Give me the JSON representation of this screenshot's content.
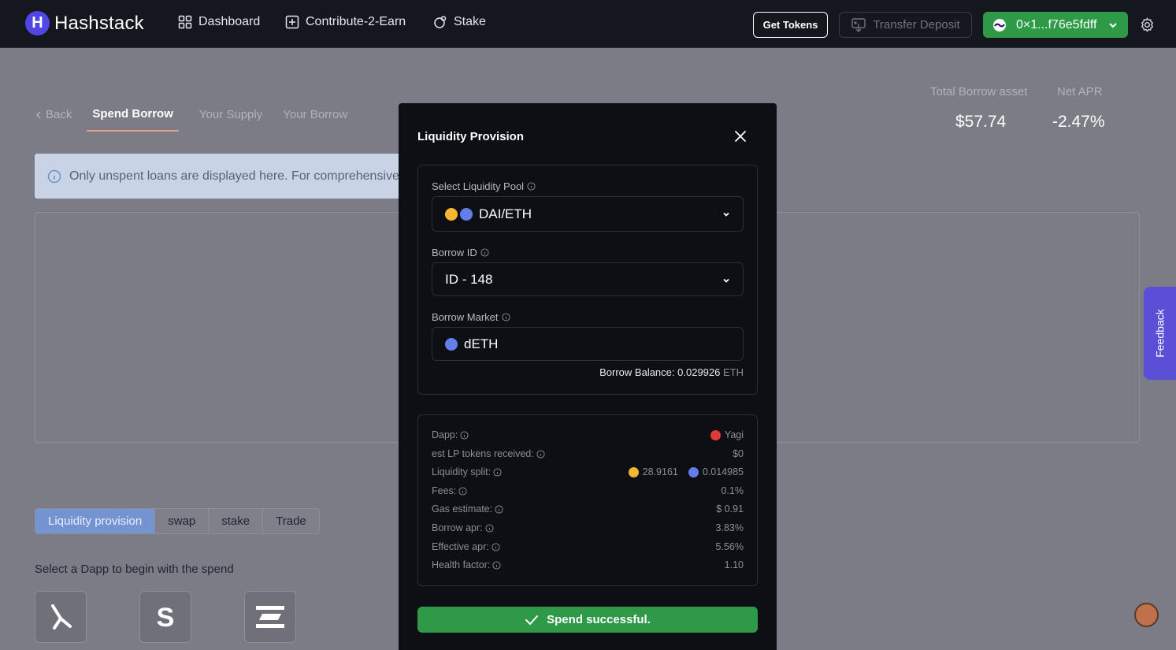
{
  "navbar": {
    "brand": "Hashstack",
    "links": [
      {
        "label": "Dashboard",
        "icon": "dashboard-icon"
      },
      {
        "label": "Contribute-2-Earn",
        "icon": "plus-square-icon"
      },
      {
        "label": "Stake",
        "icon": "stake-icon"
      }
    ],
    "get_tokens": "Get Tokens",
    "transfer_deposit": "Transfer Deposit",
    "wallet_address": "0×1...f76e5fdff"
  },
  "page": {
    "back": "Back",
    "tabs": [
      "Spend Borrow",
      "Your Supply",
      "Your Borrow"
    ],
    "stats": [
      {
        "label": "Total Borrow asset",
        "value": "$57.74"
      },
      {
        "label": "Net APR",
        "value": "-2.47%"
      }
    ],
    "info_banner": "Only unspent loans are displayed here. For comprehensive list of active loans go to",
    "segments": [
      "Liquidity provision",
      "swap",
      "stake",
      "Trade"
    ],
    "select_dapp_text": "Select a Dapp to begin with the spend",
    "feedback": "Feedback"
  },
  "modal": {
    "title": "Liquidity Provision",
    "pool_label": "Select Liquidity Pool",
    "pool_value": "DAI/ETH",
    "borrow_id_label": "Borrow ID",
    "borrow_id_value": "ID - 148",
    "market_label": "Borrow Market",
    "market_value": "dETH",
    "balance_label": "Borrow Balance:",
    "balance_value": "0.029926",
    "balance_unit": "ETH",
    "details": {
      "dapp_label": "Dapp:",
      "dapp_value": "Yagi",
      "lp_label": "est LP tokens received:",
      "lp_value": "$0",
      "split_label": "Liquidity split:",
      "split_dai": "28.9161",
      "split_eth": "0.014985",
      "fees_label": "Fees:",
      "fees_value": "0.1%",
      "gas_label": "Gas estimate:",
      "gas_value": "$ 0.91",
      "borrow_apr_label": "Borrow apr:",
      "borrow_apr_value": "3.83%",
      "effective_apr_label": "Effective apr:",
      "effective_apr_value": "5.56%",
      "health_label": "Health factor:",
      "health_value": "1.10"
    },
    "success": "Spend successful."
  }
}
